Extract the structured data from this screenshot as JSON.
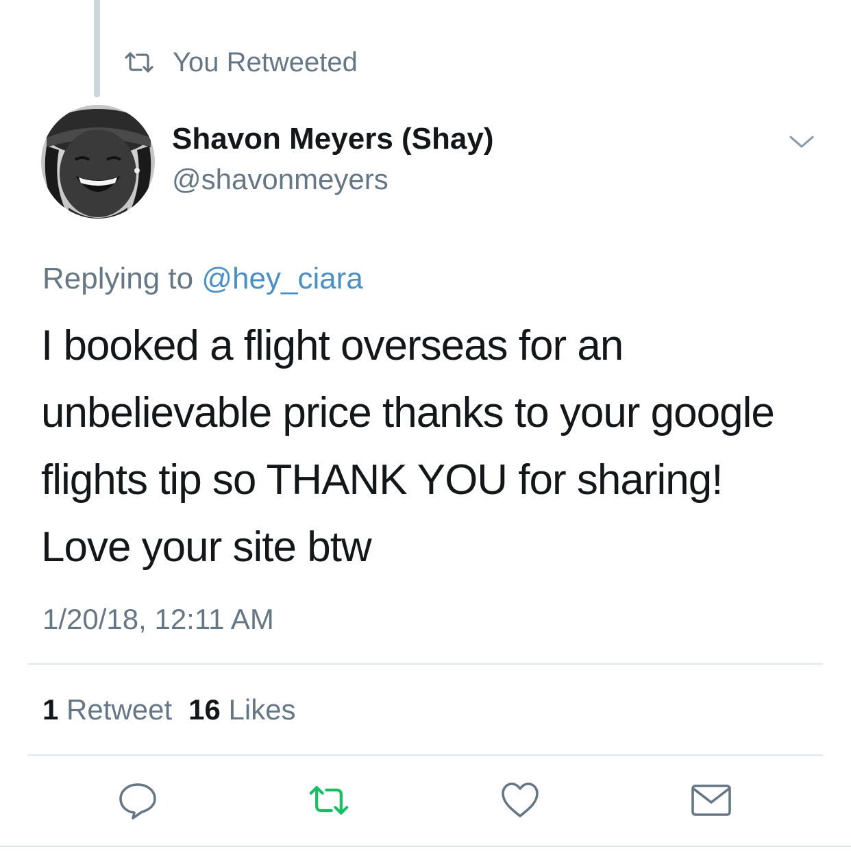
{
  "retweet_context": {
    "icon": "retweet-icon",
    "label": "You Retweeted"
  },
  "author": {
    "name": "Shavon Meyers (Shay)",
    "handle": "@shavonmeyers",
    "avatar": "avatar-photo"
  },
  "menu": {
    "icon": "chevron-down-icon"
  },
  "reply": {
    "prefix": "Replying to ",
    "mention": "@hey_ciara"
  },
  "tweet": {
    "text": "I booked a flight overseas for an unbelievable price thanks to your google flights tip so THANK YOU for sharing! Love your site btw",
    "timestamp": "1/20/18, 12:11 AM"
  },
  "stats": {
    "retweets_count": "1",
    "retweets_label": "Retweet",
    "likes_count": "16",
    "likes_label": "Likes"
  },
  "actions": [
    {
      "icon": "reply-icon"
    },
    {
      "icon": "retweet-icon",
      "color": "#17bf63"
    },
    {
      "icon": "heart-icon"
    },
    {
      "icon": "mail-icon"
    }
  ],
  "colors": {
    "text": "#14171a",
    "secondary": "#657786",
    "link": "#4a90c8",
    "retweet_active": "#17bf63",
    "divider": "#e1e8ed"
  }
}
